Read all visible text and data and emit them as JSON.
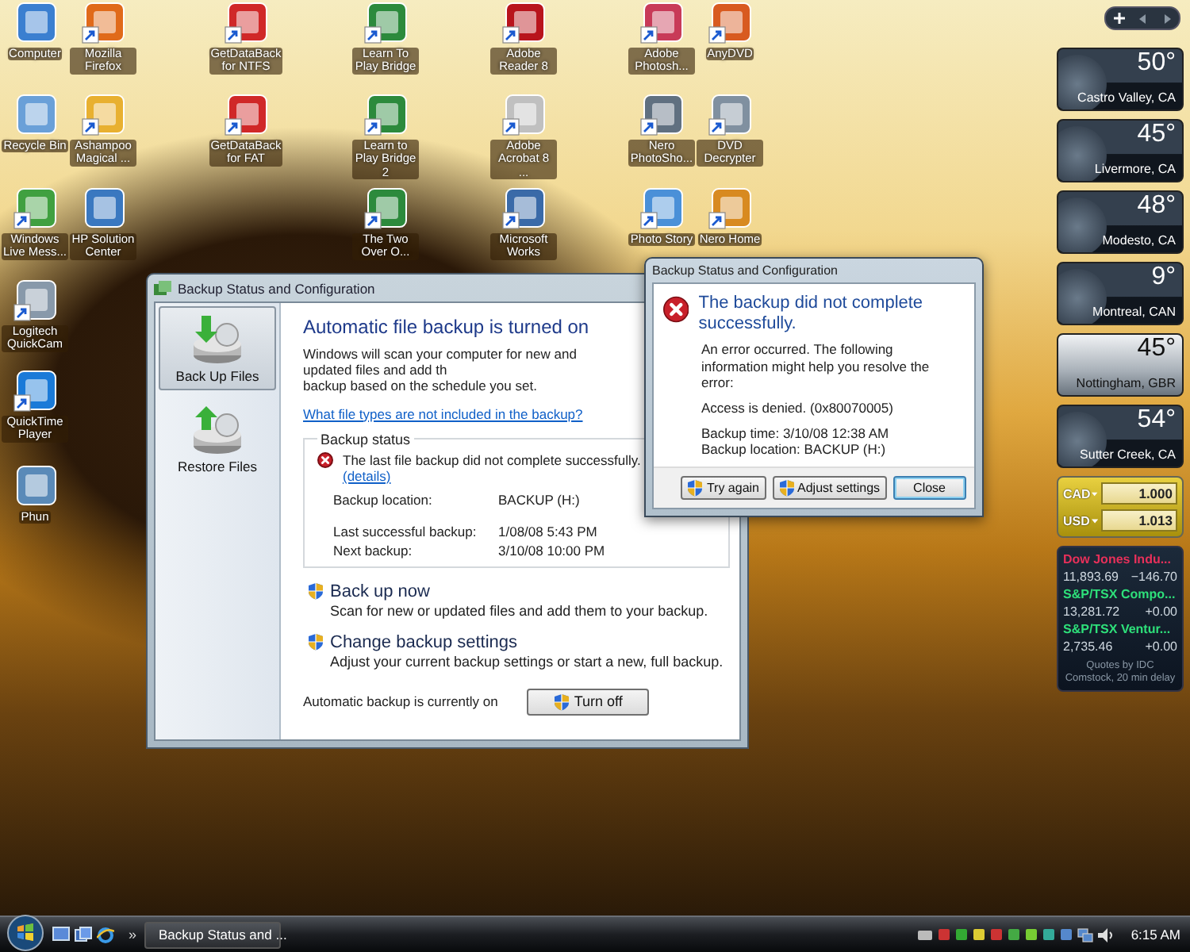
{
  "desktop_icons": [
    {
      "label": "Computer",
      "shortcut": false
    },
    {
      "label": "Mozilla Firefox",
      "shortcut": true
    },
    {
      "label": "GetDataBack for NTFS",
      "shortcut": true
    },
    {
      "label": "Learn To Play Bridge",
      "shortcut": true
    },
    {
      "label": "Adobe Reader 8",
      "shortcut": true
    },
    {
      "label": "Adobe Photosh...",
      "shortcut": true
    },
    {
      "label": "AnyDVD",
      "shortcut": true
    },
    {
      "label": "Recycle Bin",
      "shortcut": false
    },
    {
      "label": "Ashampoo Magical ...",
      "shortcut": true
    },
    {
      "label": "GetDataBack for FAT",
      "shortcut": true
    },
    {
      "label": "Learn to Play Bridge 2",
      "shortcut": true
    },
    {
      "label": "Adobe Acrobat 8 ...",
      "shortcut": true
    },
    {
      "label": "Nero PhotoSho...",
      "shortcut": true
    },
    {
      "label": "DVD Decrypter",
      "shortcut": true
    },
    {
      "label": "Windows Live Mess...",
      "shortcut": true
    },
    {
      "label": "HP Solution Center",
      "shortcut": false
    },
    {
      "label": "The Two Over O...",
      "shortcut": true
    },
    {
      "label": "Microsoft Works",
      "shortcut": true
    },
    {
      "label": "Photo Story",
      "shortcut": true
    },
    {
      "label": "Nero Home",
      "shortcut": true
    },
    {
      "label": "Logitech QuickCam",
      "shortcut": true
    },
    {
      "label": "QuickTime Player",
      "shortcut": true
    },
    {
      "label": "Phun",
      "shortcut": false
    }
  ],
  "backup_window": {
    "title": "Backup Status and Configuration",
    "sidebar": [
      {
        "label": "Back Up Files",
        "selected": true
      },
      {
        "label": "Restore Files",
        "selected": false
      }
    ],
    "heading": "Automatic file backup is turned on",
    "description_lines": [
      "Windows will scan your computer for new and updated files and add th",
      "backup based on the schedule you set."
    ],
    "link": "What file types are not included in the backup?",
    "status": {
      "legend": "Backup status",
      "message": "The last file backup did not complete successfully.",
      "details_link": "(details)",
      "fields": [
        {
          "label": "Backup location:",
          "value": "BACKUP (H:)"
        },
        {
          "label": "Last successful backup:",
          "value": "1/08/08 5:43 PM"
        },
        {
          "label": "Next backup:",
          "value": "3/10/08 10:00 PM"
        }
      ]
    },
    "tasks": [
      {
        "title": "Back up now",
        "description": "Scan for new or updated files and add them to your backup.",
        "shield": true
      },
      {
        "title": "Change backup settings",
        "description": "Adjust your current backup settings or start a new, full backup.",
        "shield": true
      }
    ],
    "footer": {
      "text": "Automatic backup is currently on",
      "button": {
        "label": "Turn off",
        "shield": true
      }
    }
  },
  "error_dialog": {
    "title": "Backup Status and Configuration",
    "heading": "The backup did not complete successfully.",
    "paragraphs": [
      "An error occurred. The following information might help you resolve the error:",
      "Access is denied. (0x80070005)"
    ],
    "details": [
      "Backup time: 3/10/08 12:38 AM",
      "Backup location: BACKUP (H:)"
    ],
    "buttons": [
      {
        "label": "Try again",
        "shield": true,
        "default": false
      },
      {
        "label": "Adjust settings",
        "shield": true,
        "default": false
      },
      {
        "label": "Close",
        "shield": false,
        "default": true
      }
    ]
  },
  "gadgets": {
    "weather": [
      {
        "temperature": "50°",
        "city": "Castro Valley, CA",
        "kind": "night"
      },
      {
        "temperature": "45°",
        "city": "Livermore, CA",
        "kind": "night"
      },
      {
        "temperature": "48°",
        "city": "Modesto, CA",
        "kind": "night"
      },
      {
        "temperature": "9°",
        "city": "Montreal, CAN",
        "kind": "night"
      },
      {
        "temperature": "45°",
        "city": "Nottingham, GBR",
        "kind": "cloudy"
      },
      {
        "temperature": "54°",
        "city": "Sutter Creek, CA",
        "kind": "night"
      }
    ],
    "currency": [
      {
        "code": "CAD",
        "value": "1.000"
      },
      {
        "code": "USD",
        "value": "1.013"
      }
    ],
    "stocks": [
      {
        "name": "Dow Jones Indu...",
        "value": "11,893.69",
        "change": "−146.70",
        "color": "#e8305a"
      },
      {
        "name": "S&P/TSX Compo...",
        "value": "13,281.72",
        "change": "+0.00",
        "color": "#2ee07a"
      },
      {
        "name": "S&P/TSX Ventur...",
        "value": "2,735.46",
        "change": "+0.00",
        "color": "#2ee07a"
      }
    ],
    "stocks_note": "Quotes by IDC Comstock, 20 min delay"
  },
  "taskbar": {
    "overflow": "»",
    "tasks": [
      {
        "label": "Backup Status and ...",
        "selected": false
      }
    ],
    "clock": "6:15 AM"
  }
}
